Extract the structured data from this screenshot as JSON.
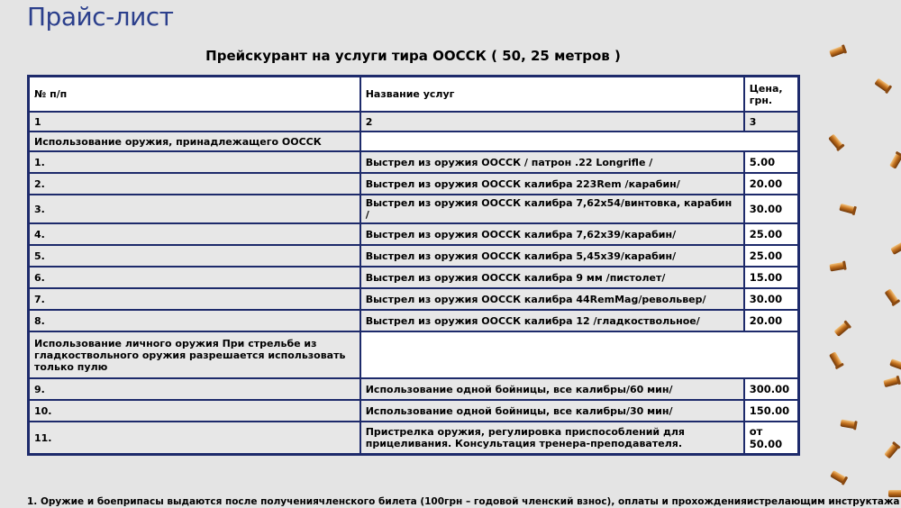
{
  "page": {
    "title": "Прайс-лист",
    "subtitle": "Прейскурант на услуги тира ООССК ( 50, 25 метров )"
  },
  "table": {
    "header": {
      "num": "№ п/п",
      "service": "Название услуг",
      "price": "Цена, грн."
    },
    "index_row": {
      "num": "1",
      "service": "2",
      "price": "3"
    },
    "section1": "Использование оружия, принадлежащего ООССК",
    "rows1": [
      {
        "num": "1.",
        "pre": "Выстрел из оружия ООССК ",
        "bold": "/ патрон .22 Longrifle /",
        "post": "",
        "price": "5.00"
      },
      {
        "num": "2.",
        "pre": "Выстрел из оружия ООССК  калибра ",
        "bold": "223Rem /",
        "post": "карабин/",
        "price": "20.00"
      },
      {
        "num": "3.",
        "pre": "Выстрел из оружия ООССК  калибра 7",
        "bold": ",62х54",
        "post": "/винтовка, карабин /",
        "price": "30.00"
      },
      {
        "num": "4.",
        "pre": "Выстрел из оружия ООССК  калибра ",
        "bold": "7,62х39/",
        "post": "карабин/",
        "price": "25.00"
      },
      {
        "num": "5.",
        "pre": "Выстрел из оружия ООССК  калибра ",
        "bold": "5,45х39/",
        "post": "карабин/",
        "price": "25.00"
      },
      {
        "num": "6.",
        "pre": "Выстрел из оружия ООССК  калибра ",
        "bold": "9 мм /",
        "post": "пистолет/",
        "price": "15.00"
      },
      {
        "num": "7.",
        "pre": "Выстрел из оружия ООССК  калибра ",
        "bold": "44RemMag/",
        "post": "револьвер/",
        "price": "30.00"
      },
      {
        "num": "8.",
        "pre": "Выстрел из оружия ООССК   калибра ",
        "bold": "12 /",
        "post": "гладкоствольное/",
        "price": "20.00"
      }
    ],
    "section2": "Использование личного оружия При стрельбе из гладкоствольного оружия разрешается использовать только пулю",
    "rows2": [
      {
        "num": "9.",
        "pre": "Использование одной бойницы,  ",
        "bold": "все калибры",
        "post": "/60 мин/",
        "price": "300.00"
      },
      {
        "num": "10.",
        "pre": "Использование одной бойницы,  ",
        "bold": "все калибры",
        "post": "/30 мин/",
        "price": "150.00"
      }
    ],
    "row11": {
      "num": "11.",
      "service": "Пристрелка оружия, регулировка приспособлений для прицеливания. Консультация тренера-преподавателя.",
      "price": "от 50.00"
    }
  },
  "footnote": "1.  Оружие и боеприпасы выдаются после получениячленского билета (100грн – годовой членский взнос), оплаты и прохожденияистрелающим инструктажа",
  "colors": {
    "title": "#2b3f8c",
    "border": "#1d2a6b",
    "background": "#e4e4e4",
    "shell": "#b8651c"
  }
}
